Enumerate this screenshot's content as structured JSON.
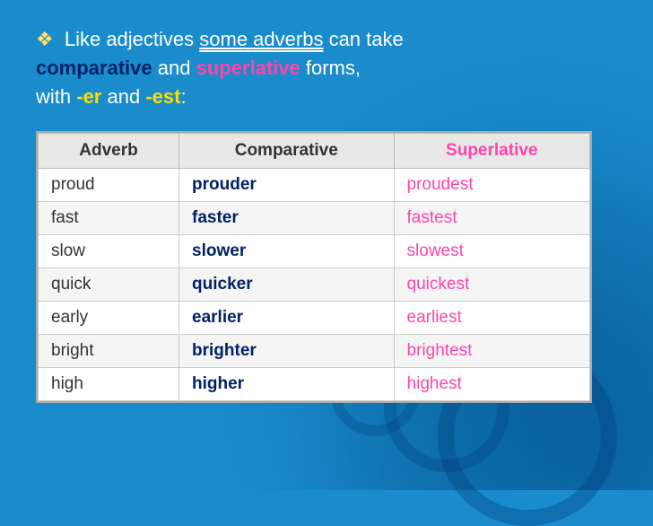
{
  "intro": {
    "bullet": "❖",
    "text_before": " Like adjectives ",
    "some_adverbs": "some adverbs",
    "text_after": " can take",
    "line2_before": "",
    "comparative": "comparative",
    "line2_mid": " and ",
    "superlative": "superlative",
    "line2_after": " forms,",
    "line3_before": "with ",
    "er": "-er",
    "line3_mid": " and ",
    "est": "-est",
    "line3_after": ":"
  },
  "table": {
    "headers": [
      "Adverb",
      "Comparative",
      "Superlative"
    ],
    "rows": [
      [
        "proud",
        "prouder",
        "proudest"
      ],
      [
        "fast",
        "faster",
        "fastest"
      ],
      [
        "slow",
        "slower",
        "slowest"
      ],
      [
        "quick",
        "quicker",
        "quickest"
      ],
      [
        "early",
        "earlier",
        "earliest"
      ],
      [
        "bright",
        "brighter",
        "brightest"
      ],
      [
        "high",
        "higher",
        "highest"
      ]
    ]
  }
}
